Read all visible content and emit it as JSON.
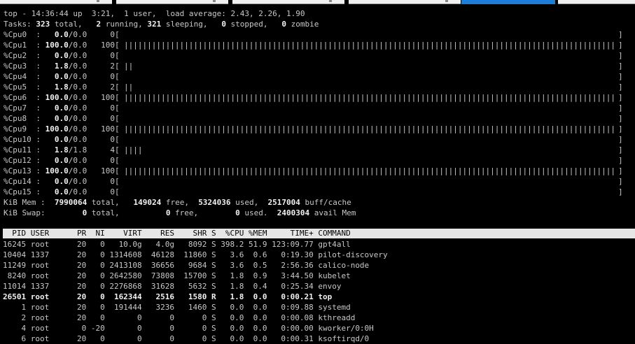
{
  "uptime_line": "top - 14:36:44 up  3:21,  1 user,  load average: 2.43, 2.26, 1.90",
  "tasks": {
    "label": "Tasks:",
    "total": "323",
    "total_label": " total,   ",
    "running": "2",
    "running_label": " running, ",
    "sleeping": "321",
    "sleeping_label": " sleeping,   ",
    "stopped": "0",
    "stopped_label": " stopped,   ",
    "zombie": "0",
    "zombie_label": " zombie"
  },
  "cpus": [
    {
      "name": "%Cpu0  : ",
      "us": "  0.0",
      "rest": "/0.0     0[",
      "pct": 0
    },
    {
      "name": "%Cpu1  : ",
      "us": "100.0",
      "rest": "/0.0   100[",
      "pct": 100
    },
    {
      "name": "%Cpu2  : ",
      "us": "  0.0",
      "rest": "/0.0     0[",
      "pct": 0
    },
    {
      "name": "%Cpu3  : ",
      "us": "  1.8",
      "rest": "/0.0     2[",
      "pct": 2
    },
    {
      "name": "%Cpu4  : ",
      "us": "  0.0",
      "rest": "/0.0     0[",
      "pct": 0
    },
    {
      "name": "%Cpu5  : ",
      "us": "  1.8",
      "rest": "/0.0     2[",
      "pct": 2
    },
    {
      "name": "%Cpu6  : ",
      "us": "100.0",
      "rest": "/0.0   100[",
      "pct": 100
    },
    {
      "name": "%Cpu7  : ",
      "us": "  0.0",
      "rest": "/0.0     0[",
      "pct": 0
    },
    {
      "name": "%Cpu8  : ",
      "us": "  0.0",
      "rest": "/0.0     0[",
      "pct": 0
    },
    {
      "name": "%Cpu9  : ",
      "us": "100.0",
      "rest": "/0.0   100[",
      "pct": 100
    },
    {
      "name": "%Cpu10 : ",
      "us": "  0.0",
      "rest": "/0.0     0[",
      "pct": 0
    },
    {
      "name": "%Cpu11 : ",
      "us": "  1.8",
      "rest": "/1.8     4[",
      "pct": 4
    },
    {
      "name": "%Cpu12 : ",
      "us": "  0.0",
      "rest": "/0.0     0[",
      "pct": 0
    },
    {
      "name": "%Cpu13 : ",
      "us": "100.0",
      "rest": "/0.0   100[",
      "pct": 100
    },
    {
      "name": "%Cpu14 : ",
      "us": "  0.0",
      "rest": "/0.0     0[",
      "pct": 0
    },
    {
      "name": "%Cpu15 : ",
      "us": "  0.0",
      "rest": "/0.0     0[",
      "pct": 0
    }
  ],
  "mem": {
    "label": "KiB Mem : ",
    "total": " 7990064",
    "total_label": " total,   ",
    "free": "149024",
    "free_label": " free,  ",
    "used": "5324036",
    "used_label": " used,  ",
    "cache": "2517004",
    "cache_label": " buff/cache"
  },
  "swap": {
    "label": "KiB Swap:        ",
    "total": "0",
    "total_label": " total,          ",
    "free": "0",
    "free_label": " free,        ",
    "used": "0",
    "used_label": " used.  ",
    "avail": "2400304",
    "avail_label": " avail Mem"
  },
  "columns_header": "  PID USER      PR  NI    VIRT    RES    SHR S  %CPU %MEM     TIME+ COMMAND",
  "processes": [
    {
      "line": "16245 root      20   0   10.0g   4.0g   8092 S 398.2 51.9 123:09.77 gpt4all",
      "bold": false
    },
    {
      "line": "10404 1337      20   0 1314608  46128  11860 S   3.6  0.6   0:19.30 pilot-discovery",
      "bold": false
    },
    {
      "line": "11249 root      20   0 2413108  36656   9684 S   3.6  0.5   2:56.36 calico-node",
      "bold": false
    },
    {
      "line": " 8240 root      20   0 2642580  73808  15700 S   1.8  0.9   3:44.50 kubelet",
      "bold": false
    },
    {
      "line": "11014 1337      20   0 2276868  31628   5632 S   1.8  0.4   0:25.34 envoy",
      "bold": false
    },
    {
      "line": "26501 root      20   0  162344   2516   1580 R   1.8  0.0   0:00.21 top",
      "bold": true
    },
    {
      "line": "    1 root      20   0  191444   3236   1460 S   0.0  0.0   0:09.88 systemd",
      "bold": false
    },
    {
      "line": "    2 root      20   0       0      0      0 S   0.0  0.0   0:00.08 kthreadd",
      "bold": false
    },
    {
      "line": "    4 root       0 -20       0      0      0 S   0.0  0.0   0:00.00 kworker/0:0H",
      "bold": false
    },
    {
      "line": "    6 root      20   0       0      0      0 S   0.0  0.0   0:00.31 ksoftirqd/0",
      "bold": false
    }
  ]
}
